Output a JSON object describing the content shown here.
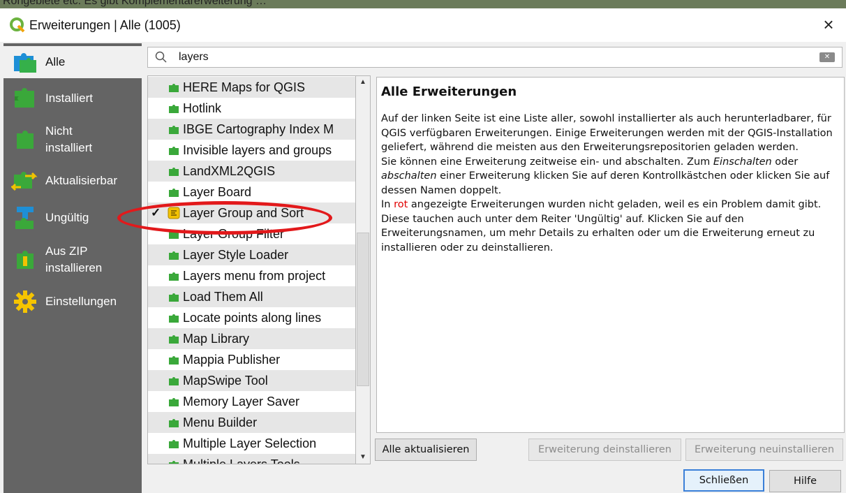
{
  "top_strip_text": "Rohgebiete etc.        Es gibt Komplementärerweiterung                 …",
  "window": {
    "title": "Erweiterungen | Alle (1005)",
    "close": "×"
  },
  "sidebar": {
    "items": [
      {
        "label": "Alle",
        "icon": "puzzle-icon-all"
      },
      {
        "label": "Installiert",
        "icon": "puzzle-installed-icon"
      },
      {
        "label": "Nicht\ninstalliert",
        "line1": "Nicht",
        "line2": "installiert",
        "icon": "puzzle-not-installed-icon"
      },
      {
        "label": "Aktualisierbar",
        "icon": "puzzle-upgradeable-icon"
      },
      {
        "label": "Ungültig",
        "icon": "puzzle-invalid-icon"
      },
      {
        "label": "Aus ZIP\ninstallieren",
        "line1": "Aus ZIP",
        "line2": "installieren",
        "icon": "zip-install-icon"
      },
      {
        "label": "Einstellungen",
        "icon": "gear-icon"
      }
    ]
  },
  "search": {
    "value": "layers"
  },
  "plugins": [
    "HERE Maps for QGIS",
    "Hotlink",
    "IBGE Cartography Index M",
    "Invisible layers and groups",
    "LandXML2QGIS",
    "Layer Board",
    "Layer Group and Sort",
    "Layer Group Filter",
    "Layer Style Loader",
    "Layers menu from project",
    "Load Them All",
    "Locate points along lines",
    "Map Library",
    "Mappia Publisher",
    "MapSwipe Tool",
    "Memory Layer Saver",
    "Menu Builder",
    "Multiple Layer Selection",
    "Multiple Layers Tools"
  ],
  "selected_plugin": "Layer Group and Sort",
  "description": {
    "title": "Alle Erweiterungen",
    "p1": "Auf der linken Seite ist eine Liste aller, sowohl installierter als auch herunterladbarer, für QGIS verfügbaren Erweiterungen. Einige Erweiterungen werden mit der QGIS-Installation geliefert, während die meisten aus den Erweiterungsrepositorien geladen werden.",
    "p2_a": "Sie können eine Erweiterung zeitweise ein- und abschalten. Zum ",
    "p2_em1": "Einschalten",
    "p2_b": " oder ",
    "p2_em2": "abschalten",
    "p2_c": " einer Erweiterung klicken Sie auf deren Kontrollkästchen oder klicken Sie auf dessen Namen doppelt.",
    "p3_a": "In ",
    "p3_red": "rot",
    "p3_b": " angezeigte Erweiterungen wurden nicht geladen, weil es ein Problem damit gibt. Diese tauchen auch unter dem Reiter 'Ungültig' auf. Klicken Sie auf den Erweiterungsnamen, um mehr Details zu erhalten oder um die Erweiterung erneut zu installieren oder zu deinstallieren."
  },
  "buttons": {
    "update_all": "Alle aktualisieren",
    "uninstall": "Erweiterung deinstallieren",
    "reinstall": "Erweiterung neuinstallieren",
    "close": "Schließen",
    "help": "Hilfe"
  },
  "colors": {
    "sidebar": "#646464",
    "highlight": "#e2191b",
    "plugin_green": "#3aa83a"
  }
}
